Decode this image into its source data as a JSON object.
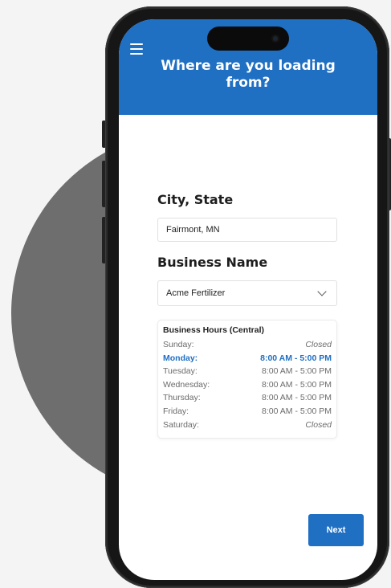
{
  "header": {
    "title": "Where are you loading from?",
    "menu_icon": "hamburger-menu-icon"
  },
  "city": {
    "label": "City, State",
    "value": "Fairmont, MN"
  },
  "business": {
    "label": "Business Name",
    "selected": "Acme Fertilizer",
    "dropdown_icon": "chevron-down-icon"
  },
  "hours": {
    "title": "Business Hours (Central)",
    "rows": [
      {
        "day": "Sunday:",
        "time": "Closed"
      },
      {
        "day": "Monday:",
        "time": "8:00 AM - 5:00 PM"
      },
      {
        "day": "Tuesday:",
        "time": "8:00 AM - 5:00 PM"
      },
      {
        "day": "Wednesday:",
        "time": "8:00 AM - 5:00 PM"
      },
      {
        "day": "Thursday:",
        "time": "8:00 AM - 5:00 PM"
      },
      {
        "day": "Friday:",
        "time": "8:00 AM - 5:00 PM"
      },
      {
        "day": "Saturday:",
        "time": "Closed"
      }
    ]
  },
  "actions": {
    "next_label": "Next"
  },
  "colors": {
    "primary": "#1f6fc3",
    "background": "#f4f4f4",
    "decor_circle": "#6e6e6e",
    "muted_text": "#6b6b6b"
  }
}
